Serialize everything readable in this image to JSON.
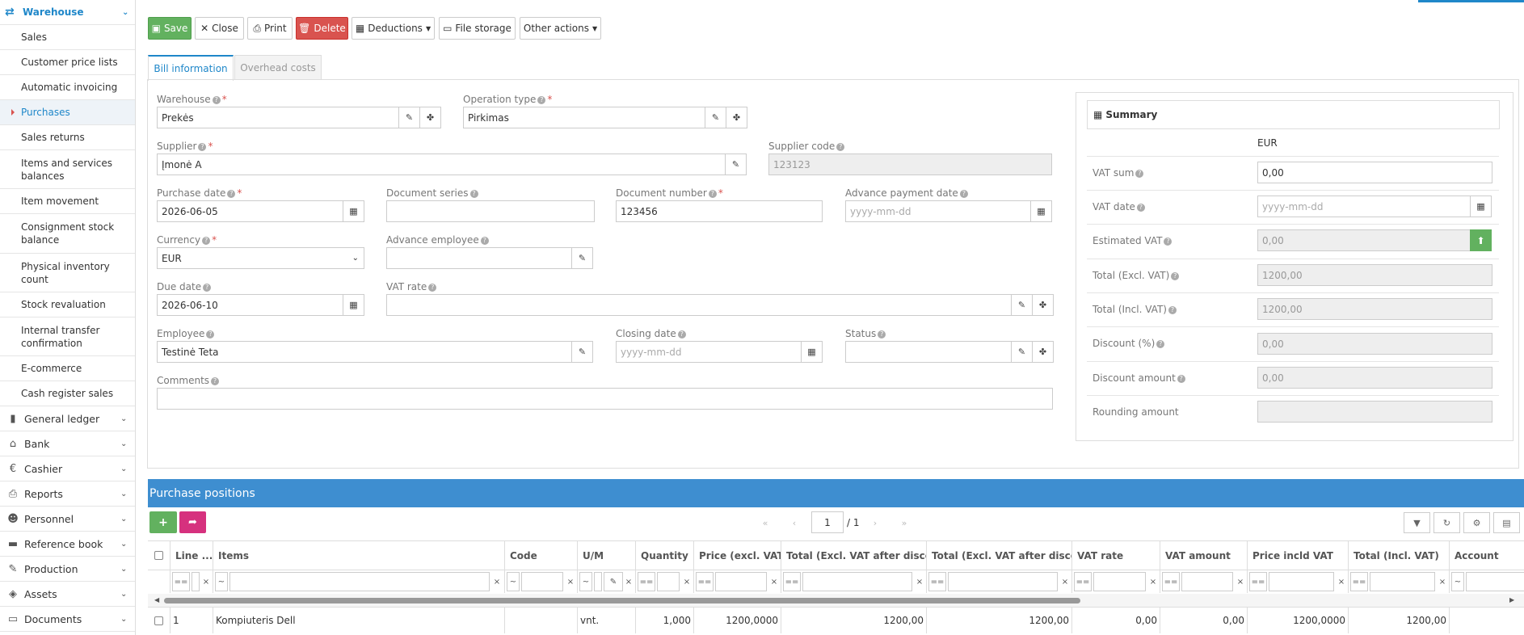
{
  "sidebar": {
    "section": {
      "label": "Warehouse",
      "icon": "arrows-exchange-icon"
    },
    "subitems": [
      {
        "label": "Sales"
      },
      {
        "label": "Customer price lists"
      },
      {
        "label": "Automatic invoicing"
      },
      {
        "label": "Purchases",
        "active": true
      },
      {
        "label": "Sales returns"
      },
      {
        "label": "Items and services balances"
      },
      {
        "label": "Item movement"
      },
      {
        "label": "Consignment stock balance"
      },
      {
        "label": "Physical inventory count"
      },
      {
        "label": "Stock revaluation"
      },
      {
        "label": "Internal transfer confirmation"
      },
      {
        "label": "E-commerce"
      },
      {
        "label": "Cash register sales"
      }
    ],
    "main": [
      {
        "label": "General ledger",
        "icon": "book-icon"
      },
      {
        "label": "Bank",
        "icon": "bank-icon"
      },
      {
        "label": "Cashier",
        "icon": "euro-icon"
      },
      {
        "label": "Reports",
        "icon": "printer-icon"
      },
      {
        "label": "Personnel",
        "icon": "users-icon"
      },
      {
        "label": "Reference book",
        "icon": "folder-icon"
      },
      {
        "label": "Production",
        "icon": "wrench-icon"
      },
      {
        "label": "Assets",
        "icon": "cube-icon"
      },
      {
        "label": "Documents",
        "icon": "inbox-icon"
      }
    ]
  },
  "toolbar": {
    "save": "Save",
    "close": "Close",
    "print": "Print",
    "delete": "Delete",
    "deductions": "Deductions",
    "file_storage": "File storage",
    "other_actions": "Other actions"
  },
  "tabs": {
    "bill_information": "Bill information",
    "overhead_costs": "Overhead costs"
  },
  "form": {
    "warehouse": {
      "label": "Warehouse",
      "value": "Prekės"
    },
    "operation_type": {
      "label": "Operation type",
      "value": "Pirkimas"
    },
    "supplier": {
      "label": "Supplier",
      "value": "Įmonė A"
    },
    "supplier_code": {
      "label": "Supplier code",
      "value": "123123"
    },
    "purchase_date": {
      "label": "Purchase date",
      "value": "2026-06-05"
    },
    "document_series": {
      "label": "Document series",
      "value": ""
    },
    "document_number": {
      "label": "Document number",
      "value": "123456"
    },
    "advance_payment_date": {
      "label": "Advance payment date",
      "placeholder": "yyyy-mm-dd"
    },
    "currency": {
      "label": "Currency",
      "value": "EUR"
    },
    "advance_employee": {
      "label": "Advance employee",
      "value": ""
    },
    "due_date": {
      "label": "Due date",
      "value": "2026-06-10"
    },
    "vat_rate": {
      "label": "VAT rate",
      "value": ""
    },
    "employee": {
      "label": "Employee",
      "value": "Testinė Teta"
    },
    "closing_date": {
      "label": "Closing date",
      "placeholder": "yyyy-mm-dd"
    },
    "status": {
      "label": "Status",
      "value": ""
    },
    "comments": {
      "label": "Comments",
      "value": ""
    }
  },
  "summary": {
    "title": "Summary",
    "currency": "EUR",
    "vat_sum": {
      "label": "VAT sum",
      "value": "0,00"
    },
    "vat_date": {
      "label": "VAT date",
      "placeholder": "yyyy-mm-dd"
    },
    "estimated_vat": {
      "label": "Estimated VAT",
      "value": "0,00"
    },
    "total_excl": {
      "label": "Total (Excl. VAT)",
      "value": "1200,00"
    },
    "total_incl": {
      "label": "Total (Incl. VAT)",
      "value": "1200,00"
    },
    "discount_pct": {
      "label": "Discount (%)",
      "value": "0,00"
    },
    "discount_amount": {
      "label": "Discount amount",
      "value": "0,00"
    },
    "rounding_amount": {
      "label": "Rounding amount",
      "value": ""
    }
  },
  "positions": {
    "title": "Purchase positions",
    "page_current": "1",
    "page_total": "/ 1",
    "columns": [
      "Line ...",
      "Items",
      "Code",
      "U/M",
      "Quantity",
      "Price (excl. VAT)",
      "Total (Excl. VAT after disco...",
      "Total (Excl. VAT after disco...",
      "VAT rate",
      "VAT amount",
      "Price incld VAT",
      "Total (Incl. VAT)",
      "Account"
    ],
    "rows": [
      {
        "line": "1",
        "items": "Kompiuteris Dell",
        "code": "",
        "um": "vnt.",
        "quantity": "1,000",
        "price_excl": "1200,0000",
        "total_excl_1": "1200,00",
        "total_excl_2": "1200,00",
        "vat_rate": "0,00",
        "vat_amount": "0,00",
        "price_incl": "1200,0000",
        "total_incl": "1200,00",
        "account": ""
      }
    ]
  },
  "colors": {
    "accent": "#1f87c9",
    "save": "#62b15f",
    "delete": "#d9534f",
    "header_bar": "#3e8ed0",
    "share": "#d6317e"
  }
}
